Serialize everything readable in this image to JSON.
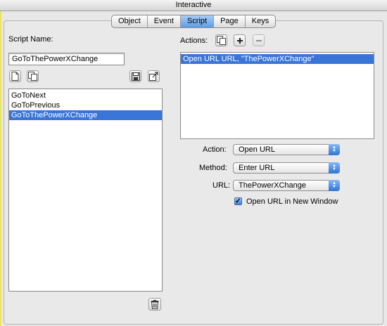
{
  "window": {
    "title": "Interactive"
  },
  "tabs": [
    {
      "label": "Object",
      "active": false
    },
    {
      "label": "Event",
      "active": false
    },
    {
      "label": "Script",
      "active": true
    },
    {
      "label": "Page",
      "active": false
    },
    {
      "label": "Keys",
      "active": false
    }
  ],
  "left": {
    "script_name_label": "Script Name:",
    "script_name_value": "GoToThePowerXChange",
    "scripts": [
      {
        "label": "GoToNext",
        "selected": false
      },
      {
        "label": "GoToPrevious",
        "selected": false
      },
      {
        "label": "GoToThePowerXChange",
        "selected": true
      }
    ]
  },
  "right": {
    "actions_label": "Actions:",
    "actions": [
      {
        "label": "Open URL  URL,  \"ThePowerXChange\"",
        "selected": true
      }
    ],
    "action_label": "Action:",
    "action_value": "Open URL",
    "method_label": "Method:",
    "method_value": "Enter URL",
    "url_label": "URL:",
    "url_value": "ThePowerXChange",
    "new_window_label": "Open URL in New Window",
    "new_window_checked": true
  },
  "colors": {
    "selection": "#3875d7",
    "active_tab": "#5e9ce8"
  }
}
